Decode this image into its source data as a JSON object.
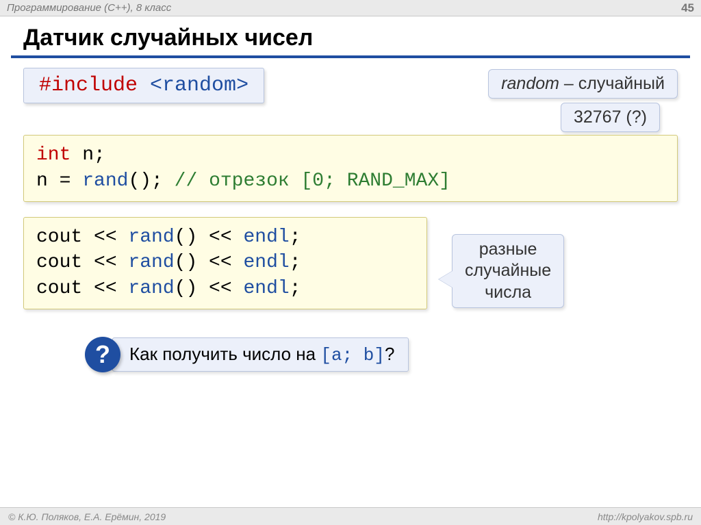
{
  "header": {
    "left": "Программирование (C++), 8 класс",
    "right": "45"
  },
  "title": "Датчик случайных чисел",
  "include": {
    "hash": "#include ",
    "lt": "<",
    "lib": "random",
    "gt": ">"
  },
  "callout_random_pre": "random",
  "callout_random_post": " – случайный",
  "callout_max": "32767 (?)",
  "code1": {
    "l1a": "int",
    "l1b": " n;",
    "l2a": "n = ",
    "l2b": "rand",
    "l2c": "();   ",
    "l2d": "// отрезок [0; RAND_MAX]"
  },
  "code2": {
    "la": "cout << ",
    "lb": "rand",
    "lc": "() << ",
    "ld": "endl",
    "le": ";"
  },
  "callout_diff_l1": "разные",
  "callout_diff_l2": "случайные",
  "callout_diff_l3": "числа",
  "question_mark": "?",
  "question_pre": "Как получить число на ",
  "question_range": "[a; b]",
  "question_post": "?",
  "footer": {
    "left": "© К.Ю. Поляков, Е.А. Ерёмин, 2019",
    "right": "http://kpolyakov.spb.ru"
  }
}
